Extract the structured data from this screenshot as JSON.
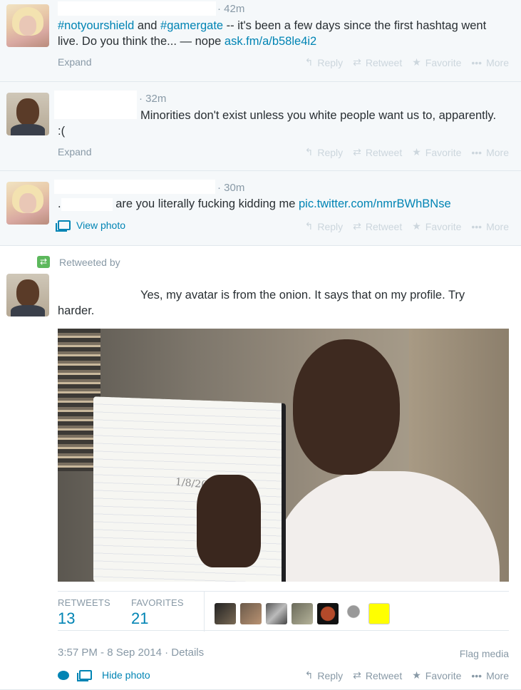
{
  "tweets": [
    {
      "time": "42m",
      "text_parts": [
        {
          "t": "#notyourshield",
          "link": true
        },
        {
          "t": " and ",
          "link": false
        },
        {
          "t": "#gamergate",
          "link": true
        },
        {
          "t": " -- it's been a few days since the first hashtag went live. Do you think the... — nope ",
          "link": false
        },
        {
          "t": "ask.fm/a/b58le4i2",
          "link": true
        }
      ],
      "expand": "Expand"
    },
    {
      "time": "32m",
      "text": "Minorities don't exist unless you white people want us to, apparently. :(",
      "expand": "Expand"
    },
    {
      "time": "30m",
      "prefix": ".",
      "text": "are you literally fucking kidding me",
      "link": "pic.twitter.com/nmrBWhBNse",
      "view_photo": "View photo"
    }
  ],
  "actions": {
    "reply": "Reply",
    "retweet": "Retweet",
    "favorite": "Favorite",
    "more": "More"
  },
  "expanded": {
    "retweeted_by": "Retweeted by",
    "text": "Yes, my avatar is from the onion. It says that on my profile. Try harder.",
    "photo_date": "1/8/2014",
    "retweets_label": "RETWEETS",
    "retweets_value": "13",
    "favorites_label": "FAVORITES",
    "favorites_value": "21",
    "timestamp": "3:57 PM - 8 Sep 2014",
    "details": "Details",
    "flag_media": "Flag media",
    "hide_photo": "Hide photo"
  },
  "colors": {
    "link": "#0084b4",
    "muted": "#8899a6",
    "retweet_green": "#5cb85c",
    "fav_yellow": "#ffff00"
  }
}
